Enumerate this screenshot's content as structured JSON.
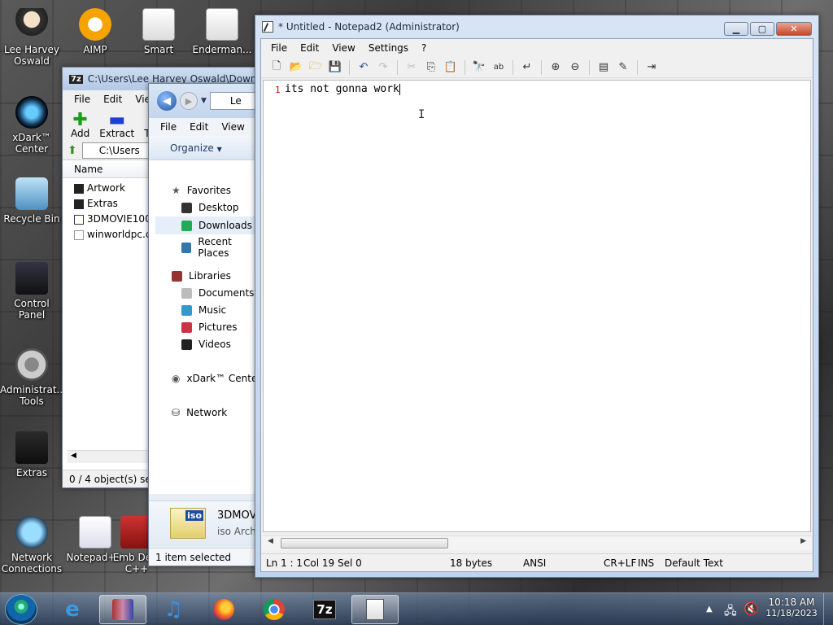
{
  "desktop": {
    "icons": [
      {
        "label": "Lee Harvey Oswald"
      },
      {
        "label": "AIMP"
      },
      {
        "label": "Smart"
      },
      {
        "label": "Enderman..."
      },
      {
        "label": "xDark™ Center"
      },
      {
        "label": "Recycle Bin"
      },
      {
        "label": "Control Panel"
      },
      {
        "label": "Administrat... Tools"
      },
      {
        "label": "Extras"
      },
      {
        "label": "Network Connections"
      },
      {
        "label": "Notepad++"
      },
      {
        "label": "Emb Dev-C++"
      }
    ]
  },
  "zip_window": {
    "title": "C:\\Users\\Lee Harvey Oswald\\Download",
    "menu": [
      "File",
      "Edit",
      "View"
    ],
    "tools": {
      "add": "Add",
      "extract": "Extract",
      "test": "T"
    },
    "path": "C:\\Users",
    "column_name": "Name",
    "files": [
      "Artwork",
      "Extras",
      "3DMOVIE100.i",
      "winworldpc.co"
    ],
    "status": "0 / 4 object(s) selec"
  },
  "explorer_window": {
    "address": "Le",
    "menu": [
      "File",
      "Edit",
      "View"
    ],
    "organize": "Organize",
    "nav": {
      "favorites": "Favorites",
      "desktop": "Desktop",
      "downloads": "Downloads",
      "recent": "Recent Places",
      "libraries": "Libraries",
      "documents": "Documents",
      "music": "Music",
      "pictures": "Pictures",
      "videos": "Videos",
      "xdark": "xDark™ Center",
      "network": "Network"
    },
    "preview": {
      "name": "3DMOV",
      "type": "iso Archi",
      "badge": "iso"
    },
    "status": "1 item selected"
  },
  "notepad": {
    "title": "* Untitled - Notepad2 (Administrator)",
    "menu": [
      "File",
      "Edit",
      "View",
      "Settings",
      "?"
    ],
    "line_number": "1",
    "text": "its not gonna work",
    "status": {
      "position": "Ln 1 : 1",
      "col": "Col 19",
      "sel": "Sel 0",
      "size": "18 bytes",
      "encoding": "ANSI",
      "eol": "CR+LF",
      "ins": "INS",
      "scheme": "Default Text"
    }
  },
  "taskbar": {
    "time": "10:18 AM",
    "date": "11/18/2023",
    "apps": [
      "start",
      "internet-explorer",
      "winrar",
      "music",
      "firefox",
      "chrome",
      "7zip",
      "notepad2"
    ],
    "sevenzip_label": "7z"
  }
}
